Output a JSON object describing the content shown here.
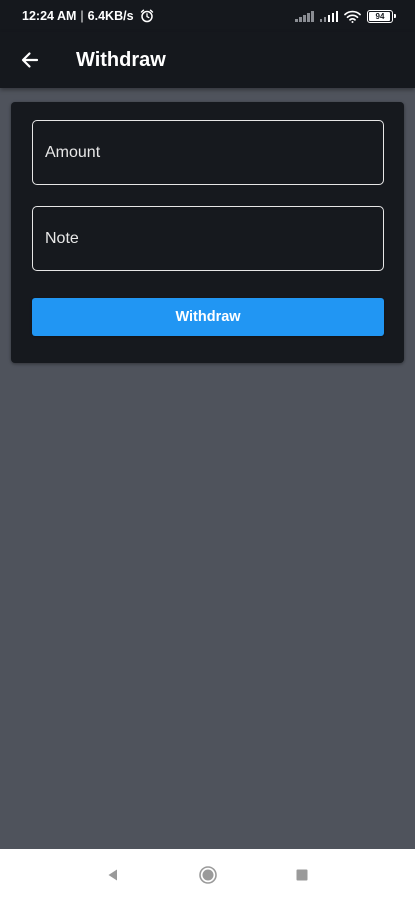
{
  "status_bar": {
    "time": "12:24 AM",
    "separator": "|",
    "network_speed": "6.4KB/s",
    "battery_level": "94",
    "battery_fraction": 0.94,
    "icons": [
      "alarm-icon",
      "signal-icon",
      "signal-icon",
      "wifi-icon",
      "battery-icon"
    ]
  },
  "app_bar": {
    "back_icon": "arrow-left-icon",
    "title": "Withdraw"
  },
  "form": {
    "amount_placeholder": "Amount",
    "amount_value": "",
    "note_placeholder": "Note",
    "note_value": "",
    "submit_label": "Withdraw"
  },
  "nav_bar": {
    "icons": [
      "back-triangle-icon",
      "home-circle-icon",
      "recents-square-icon"
    ]
  },
  "colors": {
    "background": "#4f535c",
    "surface": "#16191e",
    "bar": "#15181d",
    "accent": "#2196f3",
    "text": "#ffffff"
  }
}
